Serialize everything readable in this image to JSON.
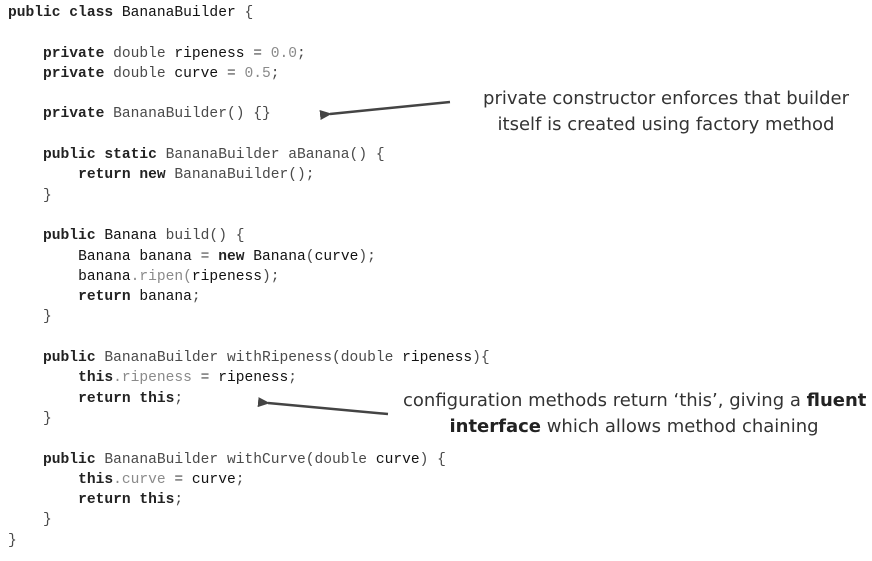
{
  "code_lines": [
    [
      {
        "t": "kw",
        "v": "public class"
      },
      {
        "t": "plain",
        "v": " "
      },
      {
        "t": "id",
        "v": "BananaBuilder"
      },
      {
        "t": "plain",
        "v": " {"
      }
    ],
    [],
    [
      {
        "t": "plain",
        "v": "    "
      },
      {
        "t": "kw",
        "v": "private"
      },
      {
        "t": "plain",
        "v": " double "
      },
      {
        "t": "id",
        "v": "ripeness"
      },
      {
        "t": "plain",
        "v": " = "
      },
      {
        "t": "dim",
        "v": "0.0"
      },
      {
        "t": "plain",
        "v": ";"
      }
    ],
    [
      {
        "t": "plain",
        "v": "    "
      },
      {
        "t": "kw",
        "v": "private"
      },
      {
        "t": "plain",
        "v": " double "
      },
      {
        "t": "id",
        "v": "curve"
      },
      {
        "t": "plain",
        "v": " = "
      },
      {
        "t": "dim",
        "v": "0.5"
      },
      {
        "t": "plain",
        "v": ";"
      }
    ],
    [],
    [
      {
        "t": "plain",
        "v": "    "
      },
      {
        "t": "kw",
        "v": "private"
      },
      {
        "t": "plain",
        "v": " BananaBuilder() {}"
      }
    ],
    [],
    [
      {
        "t": "plain",
        "v": "    "
      },
      {
        "t": "kw",
        "v": "public static"
      },
      {
        "t": "plain",
        "v": " BananaBuilder aBanana() {"
      }
    ],
    [
      {
        "t": "plain",
        "v": "        "
      },
      {
        "t": "kw",
        "v": "return new"
      },
      {
        "t": "plain",
        "v": " BananaBuilder();"
      }
    ],
    [
      {
        "t": "plain",
        "v": "    }"
      }
    ],
    [],
    [
      {
        "t": "plain",
        "v": "    "
      },
      {
        "t": "kw",
        "v": "public"
      },
      {
        "t": "plain",
        "v": " "
      },
      {
        "t": "id",
        "v": "Banana"
      },
      {
        "t": "plain",
        "v": " build() {"
      }
    ],
    [
      {
        "t": "plain",
        "v": "        "
      },
      {
        "t": "id",
        "v": "Banana banana"
      },
      {
        "t": "plain",
        "v": " = "
      },
      {
        "t": "kw",
        "v": "new"
      },
      {
        "t": "plain",
        "v": " "
      },
      {
        "t": "id",
        "v": "Banana"
      },
      {
        "t": "plain",
        "v": "("
      },
      {
        "t": "id",
        "v": "curve"
      },
      {
        "t": "plain",
        "v": ");"
      }
    ],
    [
      {
        "t": "plain",
        "v": "        "
      },
      {
        "t": "id",
        "v": "banana"
      },
      {
        "t": "dim",
        "v": ".ripen("
      },
      {
        "t": "id",
        "v": "ripeness"
      },
      {
        "t": "plain",
        "v": ");"
      }
    ],
    [
      {
        "t": "plain",
        "v": "        "
      },
      {
        "t": "kw",
        "v": "return"
      },
      {
        "t": "plain",
        "v": " "
      },
      {
        "t": "id",
        "v": "banana"
      },
      {
        "t": "plain",
        "v": ";"
      }
    ],
    [
      {
        "t": "plain",
        "v": "    }"
      }
    ],
    [],
    [
      {
        "t": "plain",
        "v": "    "
      },
      {
        "t": "kw",
        "v": "public"
      },
      {
        "t": "plain",
        "v": " BananaBuilder withRipeness(double "
      },
      {
        "t": "id",
        "v": "ripeness"
      },
      {
        "t": "plain",
        "v": "){"
      }
    ],
    [
      {
        "t": "plain",
        "v": "        "
      },
      {
        "t": "kw",
        "v": "this"
      },
      {
        "t": "dim",
        "v": ".ripeness"
      },
      {
        "t": "plain",
        "v": " = "
      },
      {
        "t": "id",
        "v": "ripeness"
      },
      {
        "t": "plain",
        "v": ";"
      }
    ],
    [
      {
        "t": "plain",
        "v": "        "
      },
      {
        "t": "kw",
        "v": "return this"
      },
      {
        "t": "plain",
        "v": ";"
      }
    ],
    [
      {
        "t": "plain",
        "v": "    }"
      }
    ],
    [],
    [
      {
        "t": "plain",
        "v": "    "
      },
      {
        "t": "kw",
        "v": "public"
      },
      {
        "t": "plain",
        "v": " BananaBuilder withCurve(double "
      },
      {
        "t": "id",
        "v": "curve"
      },
      {
        "t": "plain",
        "v": ") {"
      }
    ],
    [
      {
        "t": "plain",
        "v": "        "
      },
      {
        "t": "kw",
        "v": "this"
      },
      {
        "t": "dim",
        "v": ".curve"
      },
      {
        "t": "plain",
        "v": " = "
      },
      {
        "t": "id",
        "v": "curve"
      },
      {
        "t": "plain",
        "v": ";"
      }
    ],
    [
      {
        "t": "plain",
        "v": "        "
      },
      {
        "t": "kw",
        "v": "return this"
      },
      {
        "t": "plain",
        "v": ";"
      }
    ],
    [
      {
        "t": "plain",
        "v": "    }"
      }
    ],
    [
      {
        "t": "plain",
        "v": "}"
      }
    ]
  ],
  "annotations": {
    "constructor": {
      "line1": "private constructor enforces that builder",
      "line2": "itself is created using factory method"
    },
    "fluent": {
      "line1_pre": "configuration methods return ‘this’, giving a ",
      "line1_bold": "fluent",
      "line2_bold": "interface",
      "line2_post": " which allows method chaining"
    }
  },
  "colors": {
    "keyword": "#222222",
    "identifier": "#111111",
    "text": "#4a4a4a",
    "literal": "#8a8a8a",
    "arrow": "#444444"
  }
}
